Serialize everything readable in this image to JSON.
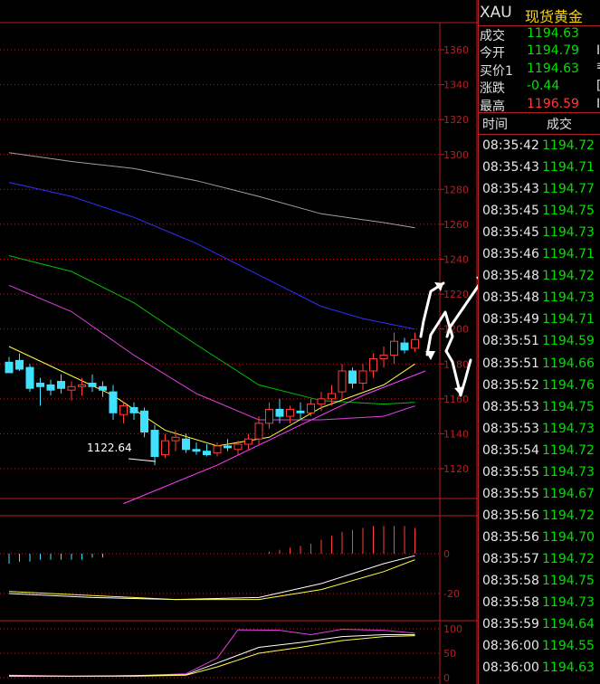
{
  "colors": {
    "up": "#ff3b3b",
    "down": "#40e0ff",
    "green": "#00e000",
    "red": "#ff3b3b",
    "grid": "#b22222",
    "yellow": "#ffd400"
  },
  "header": {
    "symbol": "XAU",
    "name": "现货黄金"
  },
  "quote": [
    {
      "label": "成交",
      "value": "1194.63",
      "color": "#00e000",
      "cut": ""
    },
    {
      "label": "今开",
      "value": "1194.79",
      "color": "#00e000",
      "cut": "I"
    },
    {
      "label": "买价1",
      "value": "1194.63",
      "color": "#00e000",
      "cut": "₹"
    },
    {
      "label": "涨跌",
      "value": "-0.44",
      "color": "#00e000",
      "cut": "["
    },
    {
      "label": "最高",
      "value": "1196.59",
      "color": "#ff3b3b",
      "cut": "I"
    }
  ],
  "ticks_header": {
    "time": "时间",
    "price": "成交"
  },
  "ticks": [
    {
      "time": "08:35:42",
      "price": "1194.72"
    },
    {
      "time": "08:35:43",
      "price": "1194.71"
    },
    {
      "time": "08:35:43",
      "price": "1194.77"
    },
    {
      "time": "08:35:45",
      "price": "1194.75"
    },
    {
      "time": "08:35:45",
      "price": "1194.73"
    },
    {
      "time": "08:35:46",
      "price": "1194.71"
    },
    {
      "time": "08:35:48",
      "price": "1194.72"
    },
    {
      "time": "08:35:48",
      "price": "1194.73"
    },
    {
      "time": "08:35:49",
      "price": "1194.71"
    },
    {
      "time": "08:35:51",
      "price": "1194.59"
    },
    {
      "time": "08:35:51",
      "price": "1194.66"
    },
    {
      "time": "08:35:52",
      "price": "1194.76"
    },
    {
      "time": "08:35:53",
      "price": "1194.75"
    },
    {
      "time": "08:35:53",
      "price": "1194.73"
    },
    {
      "time": "08:35:54",
      "price": "1194.72"
    },
    {
      "time": "08:35:55",
      "price": "1194.73"
    },
    {
      "time": "08:35:55",
      "price": "1194.67"
    },
    {
      "time": "08:35:56",
      "price": "1194.72"
    },
    {
      "time": "08:35:56",
      "price": "1194.70"
    },
    {
      "time": "08:35:57",
      "price": "1194.72"
    },
    {
      "time": "08:35:58",
      "price": "1194.75"
    },
    {
      "time": "08:35:58",
      "price": "1194.73"
    },
    {
      "time": "08:35:59",
      "price": "1194.64"
    },
    {
      "time": "08:36:00",
      "price": "1194.55"
    },
    {
      "time": "08:36:00",
      "price": "1194.63"
    }
  ],
  "chart_data": [
    {
      "type": "candlestick",
      "y_ticks": [
        1360,
        1340,
        1320,
        1300,
        1280,
        1260,
        1240,
        1220,
        1200,
        1180,
        1160,
        1140,
        1120
      ],
      "ylim": [
        1105,
        1368
      ],
      "annotation": "1122.64",
      "candles": [
        {
          "o": 1181,
          "h": 1184,
          "l": 1176,
          "c": 1175
        },
        {
          "o": 1182,
          "h": 1186,
          "l": 1176,
          "c": 1177
        },
        {
          "o": 1178,
          "h": 1180,
          "l": 1164,
          "c": 1166
        },
        {
          "o": 1169,
          "h": 1172,
          "l": 1156,
          "c": 1167
        },
        {
          "o": 1168,
          "h": 1171,
          "l": 1162,
          "c": 1165
        },
        {
          "o": 1170,
          "h": 1174,
          "l": 1163,
          "c": 1166
        },
        {
          "o": 1165,
          "h": 1170,
          "l": 1159,
          "c": 1167
        },
        {
          "o": 1167,
          "h": 1172,
          "l": 1162,
          "c": 1168
        },
        {
          "o": 1169,
          "h": 1174,
          "l": 1164,
          "c": 1167
        },
        {
          "o": 1167,
          "h": 1170,
          "l": 1161,
          "c": 1165
        },
        {
          "o": 1164,
          "h": 1168,
          "l": 1148,
          "c": 1152
        },
        {
          "o": 1151,
          "h": 1158,
          "l": 1146,
          "c": 1156
        },
        {
          "o": 1155,
          "h": 1158,
          "l": 1148,
          "c": 1152
        },
        {
          "o": 1153,
          "h": 1155,
          "l": 1138,
          "c": 1141
        },
        {
          "o": 1142,
          "h": 1145,
          "l": 1122,
          "c": 1127
        },
        {
          "o": 1128,
          "h": 1140,
          "l": 1126,
          "c": 1136
        },
        {
          "o": 1136,
          "h": 1142,
          "l": 1130,
          "c": 1138
        },
        {
          "o": 1137,
          "h": 1140,
          "l": 1129,
          "c": 1131
        },
        {
          "o": 1131,
          "h": 1135,
          "l": 1128,
          "c": 1130
        },
        {
          "o": 1130,
          "h": 1134,
          "l": 1127,
          "c": 1128
        },
        {
          "o": 1129,
          "h": 1135,
          "l": 1127,
          "c": 1133
        },
        {
          "o": 1133,
          "h": 1137,
          "l": 1130,
          "c": 1132
        },
        {
          "o": 1131,
          "h": 1136,
          "l": 1128,
          "c": 1134
        },
        {
          "o": 1134,
          "h": 1140,
          "l": 1131,
          "c": 1137
        },
        {
          "o": 1137,
          "h": 1150,
          "l": 1134,
          "c": 1146
        },
        {
          "o": 1146,
          "h": 1158,
          "l": 1143,
          "c": 1154
        },
        {
          "o": 1154,
          "h": 1160,
          "l": 1146,
          "c": 1150
        },
        {
          "o": 1150,
          "h": 1156,
          "l": 1146,
          "c": 1154
        },
        {
          "o": 1153,
          "h": 1158,
          "l": 1148,
          "c": 1152
        },
        {
          "o": 1152,
          "h": 1160,
          "l": 1150,
          "c": 1157
        },
        {
          "o": 1157,
          "h": 1164,
          "l": 1153,
          "c": 1160
        },
        {
          "o": 1160,
          "h": 1168,
          "l": 1156,
          "c": 1163
        },
        {
          "o": 1164,
          "h": 1180,
          "l": 1160,
          "c": 1176
        },
        {
          "o": 1176,
          "h": 1178,
          "l": 1166,
          "c": 1169
        },
        {
          "o": 1169,
          "h": 1180,
          "l": 1165,
          "c": 1176
        },
        {
          "o": 1176,
          "h": 1186,
          "l": 1172,
          "c": 1183
        },
        {
          "o": 1183,
          "h": 1190,
          "l": 1178,
          "c": 1185
        },
        {
          "o": 1185,
          "h": 1198,
          "l": 1180,
          "c": 1193
        },
        {
          "o": 1192,
          "h": 1195,
          "l": 1186,
          "c": 1188
        },
        {
          "o": 1189,
          "h": 1198,
          "l": 1187,
          "c": 1194
        }
      ],
      "ma": [
        {
          "color": "#a0a0a0",
          "points": [
            [
              0,
              1301
            ],
            [
              6,
              1296
            ],
            [
              12,
              1292
            ],
            [
              18,
              1285
            ],
            [
              24,
              1276
            ],
            [
              30,
              1266
            ],
            [
              36,
              1261
            ],
            [
              39,
              1258
            ]
          ]
        },
        {
          "color": "#2f2fff",
          "points": [
            [
              0,
              1284
            ],
            [
              6,
              1276
            ],
            [
              12,
              1264
            ],
            [
              18,
              1249
            ],
            [
              24,
              1231
            ],
            [
              30,
              1213
            ],
            [
              34,
              1206
            ],
            [
              39,
              1200
            ]
          ]
        },
        {
          "color": "#00c000",
          "points": [
            [
              0,
              1242
            ],
            [
              6,
              1233
            ],
            [
              12,
              1215
            ],
            [
              18,
              1191
            ],
            [
              24,
              1168
            ],
            [
              30,
              1159
            ],
            [
              36,
              1157
            ],
            [
              39,
              1158
            ]
          ]
        },
        {
          "color": "#e040e0",
          "points": [
            [
              0,
              1225
            ],
            [
              6,
              1210
            ],
            [
              12,
              1185
            ],
            [
              18,
              1163
            ],
            [
              24,
              1148
            ],
            [
              30,
              1148
            ],
            [
              36,
              1150
            ],
            [
              39,
              1156
            ]
          ]
        },
        {
          "color": "#ffff40",
          "points": [
            [
              0,
              1190
            ],
            [
              5,
              1176
            ],
            [
              10,
              1162
            ],
            [
              15,
              1142
            ],
            [
              20,
              1133
            ],
            [
              25,
              1138
            ],
            [
              30,
              1155
            ],
            [
              36,
              1168
            ],
            [
              39,
              1180
            ]
          ]
        },
        {
          "color": "#ff40ff",
          "points": [
            [
              11,
              1100
            ],
            [
              20,
              1122
            ],
            [
              28,
              1145
            ],
            [
              34,
              1162
            ],
            [
              40,
              1176
            ]
          ]
        }
      ]
    },
    {
      "type": "bar",
      "y_ticks": [
        0,
        -20
      ],
      "ylim": [
        -26,
        18
      ],
      "hist": [
        -5,
        -4,
        -4,
        -3,
        -3,
        -3,
        -3,
        -3,
        -2,
        -2,
        0,
        0,
        0,
        0,
        0,
        0,
        0,
        0,
        0,
        0,
        0,
        0,
        0,
        0,
        0,
        1,
        2,
        3,
        4,
        5,
        7,
        9,
        11,
        12,
        13,
        14,
        14,
        14,
        14,
        13
      ],
      "lines": [
        {
          "color": "#ffffff",
          "points": [
            [
              0,
              -20
            ],
            [
              8,
              -22
            ],
            [
              16,
              -23
            ],
            [
              24,
              -22
            ],
            [
              30,
              -15
            ],
            [
              36,
              -5
            ],
            [
              39,
              -1
            ]
          ]
        },
        {
          "color": "#ffff40",
          "points": [
            [
              0,
              -19
            ],
            [
              8,
              -21
            ],
            [
              16,
              -23
            ],
            [
              24,
              -23
            ],
            [
              30,
              -18
            ],
            [
              36,
              -9
            ],
            [
              39,
              -3
            ]
          ]
        }
      ]
    },
    {
      "type": "line",
      "y_ticks": [
        100,
        50,
        0
      ],
      "ylim": [
        0,
        110
      ],
      "lines": [
        {
          "color": "#e040e0",
          "points": [
            [
              0,
              5
            ],
            [
              6,
              3
            ],
            [
              12,
              4
            ],
            [
              17,
              8
            ],
            [
              20,
              40
            ],
            [
              22,
              98
            ],
            [
              26,
              97
            ],
            [
              29,
              88
            ],
            [
              32,
              99
            ],
            [
              36,
              97
            ],
            [
              39,
              91
            ]
          ]
        },
        {
          "color": "#ffffff",
          "points": [
            [
              0,
              4
            ],
            [
              6,
              3
            ],
            [
              12,
              4
            ],
            [
              17,
              6
            ],
            [
              20,
              30
            ],
            [
              24,
              62
            ],
            [
              28,
              72
            ],
            [
              32,
              84
            ],
            [
              36,
              88
            ],
            [
              39,
              88
            ]
          ]
        },
        {
          "color": "#ffff40",
          "points": [
            [
              0,
              3
            ],
            [
              6,
              3
            ],
            [
              12,
              3
            ],
            [
              17,
              5
            ],
            [
              20,
              22
            ],
            [
              24,
              50
            ],
            [
              28,
              62
            ],
            [
              32,
              76
            ],
            [
              36,
              84
            ],
            [
              39,
              86
            ]
          ]
        }
      ]
    }
  ]
}
